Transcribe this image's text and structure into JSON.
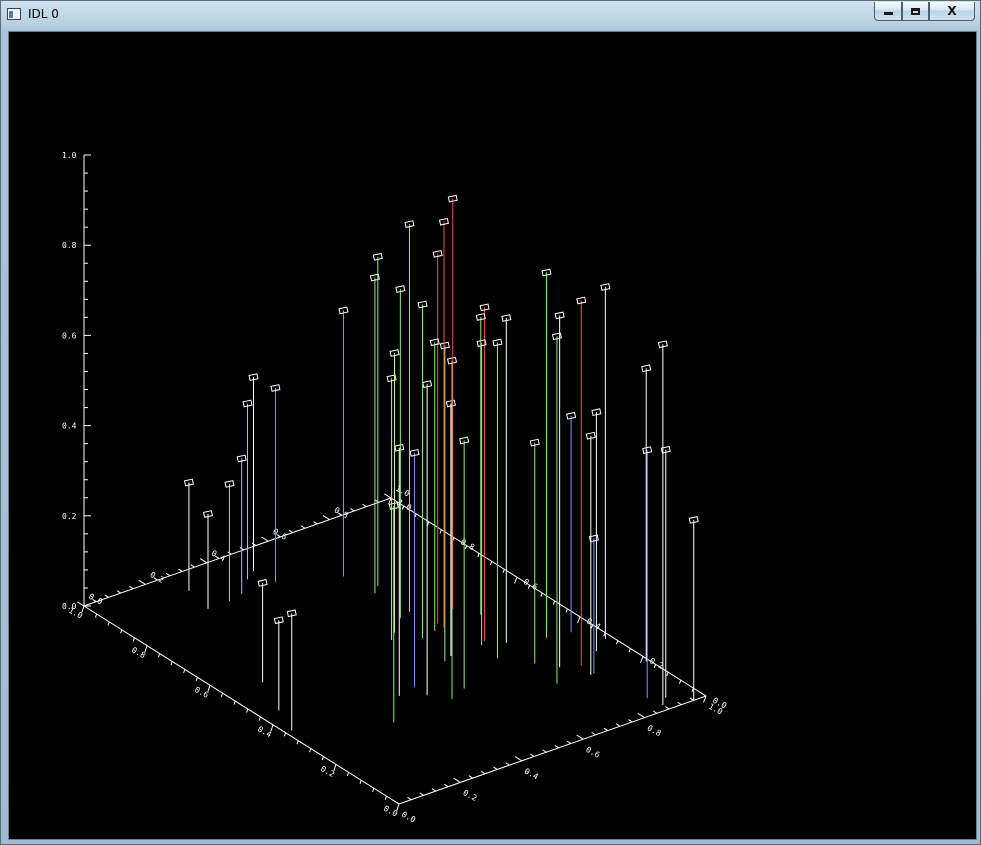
{
  "window": {
    "title": "IDL 0",
    "controls": {
      "minimize": "",
      "maximize": "",
      "close": "X"
    }
  },
  "colors": {
    "window_frame": "#b8d2e2",
    "plot_background": "#000000",
    "axes": "#ffffff",
    "stem_colors": {
      "white": "#ffffff",
      "green": "#8ef07a",
      "blue": "#8f8fff",
      "red": "#ff4a4a",
      "yellow_green": "#d8f58a",
      "lavender": "#b9b2ff"
    }
  },
  "chart_data": {
    "type": "scatter",
    "subtype": "3d-stem-plot",
    "title": "",
    "xlabel": "",
    "ylabel": "",
    "zlabel": "",
    "xlim": [
      0,
      1
    ],
    "ylim": [
      0,
      1
    ],
    "zlim": [
      0,
      1
    ],
    "x_tick_labels": [
      "0.0",
      "0.2",
      "0.4",
      "0.6",
      "0.8",
      "1.0"
    ],
    "y_tick_labels": [
      "0.0",
      "0.2",
      "0.4",
      "0.6",
      "0.8",
      "1.0"
    ],
    "z_tick_labels": [
      "0.0",
      "0.2",
      "0.4",
      "0.6",
      "0.8",
      "1.0"
    ],
    "grid": false,
    "marker": "square",
    "points": [
      {
        "x": 0.27,
        "y": 0.93,
        "z": 0.24,
        "color": "white"
      },
      {
        "x": 0.25,
        "y": 0.85,
        "z": 0.21,
        "color": "white"
      },
      {
        "x": 0.32,
        "y": 0.85,
        "z": 0.26,
        "color": "lavender"
      },
      {
        "x": 0.37,
        "y": 0.86,
        "z": 0.3,
        "color": "lavender"
      },
      {
        "x": 0.43,
        "y": 0.9,
        "z": 0.39,
        "color": "lavender"
      },
      {
        "x": 0.47,
        "y": 0.92,
        "z": 0.43,
        "color": "white"
      },
      {
        "x": 0.48,
        "y": 0.86,
        "z": 0.43,
        "color": "blue"
      },
      {
        "x": 0.12,
        "y": 0.55,
        "z": 0.22,
        "color": "white"
      },
      {
        "x": 0.06,
        "y": 0.44,
        "z": 0.2,
        "color": "white"
      },
      {
        "x": 0.02,
        "y": 0.36,
        "z": 0.26,
        "color": "white"
      },
      {
        "x": 0.64,
        "y": 0.8,
        "z": 0.59,
        "color": "blue"
      },
      {
        "x": 0.65,
        "y": 0.71,
        "z": 0.7,
        "color": "green"
      },
      {
        "x": 0.68,
        "y": 0.73,
        "z": 0.73,
        "color": "green"
      },
      {
        "x": 0.36,
        "y": 0.35,
        "z": 0.55,
        "color": "white"
      },
      {
        "x": 0.26,
        "y": 0.27,
        "z": 0.48,
        "color": "green"
      },
      {
        "x": 0.42,
        "y": 0.36,
        "z": 0.52,
        "color": "blue"
      },
      {
        "x": 0.6,
        "y": 0.42,
        "z": 0.56,
        "color": "white"
      },
      {
        "x": 0.52,
        "y": 0.3,
        "z": 0.55,
        "color": "green"
      },
      {
        "x": 0.42,
        "y": 0.32,
        "z": 0.69,
        "color": "white"
      },
      {
        "x": 0.53,
        "y": 0.54,
        "z": 0.58,
        "color": "yellow_green"
      },
      {
        "x": 0.56,
        "y": 0.56,
        "z": 0.62,
        "color": "yellow_green"
      },
      {
        "x": 0.62,
        "y": 0.6,
        "z": 0.73,
        "color": "green"
      },
      {
        "x": 0.66,
        "y": 0.61,
        "z": 0.86,
        "color": "green"
      },
      {
        "x": 0.46,
        "y": 0.28,
        "z": 0.75,
        "color": "green"
      },
      {
        "x": 0.57,
        "y": 0.41,
        "z": 0.7,
        "color": "green"
      },
      {
        "x": 0.6,
        "y": 0.51,
        "z": 0.74,
        "color": "green"
      },
      {
        "x": 0.68,
        "y": 0.52,
        "z": 0.9,
        "color": "red"
      },
      {
        "x": 0.76,
        "y": 0.57,
        "z": 0.91,
        "color": "red"
      },
      {
        "x": 0.68,
        "y": 0.54,
        "z": 0.82,
        "color": "red"
      },
      {
        "x": 0.65,
        "y": 0.52,
        "z": 0.64,
        "color": "green"
      },
      {
        "x": 0.72,
        "y": 0.43,
        "z": 0.74,
        "color": "red"
      },
      {
        "x": 0.7,
        "y": 0.42,
        "z": 0.67,
        "color": "green"
      },
      {
        "x": 0.8,
        "y": 0.52,
        "z": 0.66,
        "color": "green"
      },
      {
        "x": 0.69,
        "y": 0.36,
        "z": 0.7,
        "color": "green"
      },
      {
        "x": 0.76,
        "y": 0.4,
        "z": 0.72,
        "color": "white"
      },
      {
        "x": 0.75,
        "y": 0.3,
        "z": 0.49,
        "color": "green"
      },
      {
        "x": 0.73,
        "y": 0.21,
        "z": 0.77,
        "color": "green"
      },
      {
        "x": 0.79,
        "y": 0.26,
        "z": 0.78,
        "color": "white"
      },
      {
        "x": 0.86,
        "y": 0.37,
        "z": 0.81,
        "color": "green"
      },
      {
        "x": 0.84,
        "y": 0.24,
        "z": 0.81,
        "color": "red"
      },
      {
        "x": 0.83,
        "y": 0.2,
        "z": 0.53,
        "color": "white"
      },
      {
        "x": 0.84,
        "y": 0.2,
        "z": 0.3,
        "color": "blue"
      },
      {
        "x": 0.93,
        "y": 0.36,
        "z": 0.48,
        "color": "blue"
      },
      {
        "x": 0.92,
        "y": 0.27,
        "z": 0.53,
        "color": "white"
      },
      {
        "x": 0.87,
        "y": 0.06,
        "z": 0.55,
        "color": "blue"
      },
      {
        "x": 0.91,
        "y": 0.04,
        "z": 0.55,
        "color": "white"
      },
      {
        "x": 0.96,
        "y": 0.0,
        "z": 0.4,
        "color": "white"
      },
      {
        "x": 0.99,
        "y": 0.18,
        "z": 0.65,
        "color": "white"
      },
      {
        "x": 0.88,
        "y": 0.02,
        "z": 0.8,
        "color": "white"
      },
      {
        "x": 0.98,
        "y": 0.3,
        "z": 0.78,
        "color": "white"
      }
    ]
  }
}
